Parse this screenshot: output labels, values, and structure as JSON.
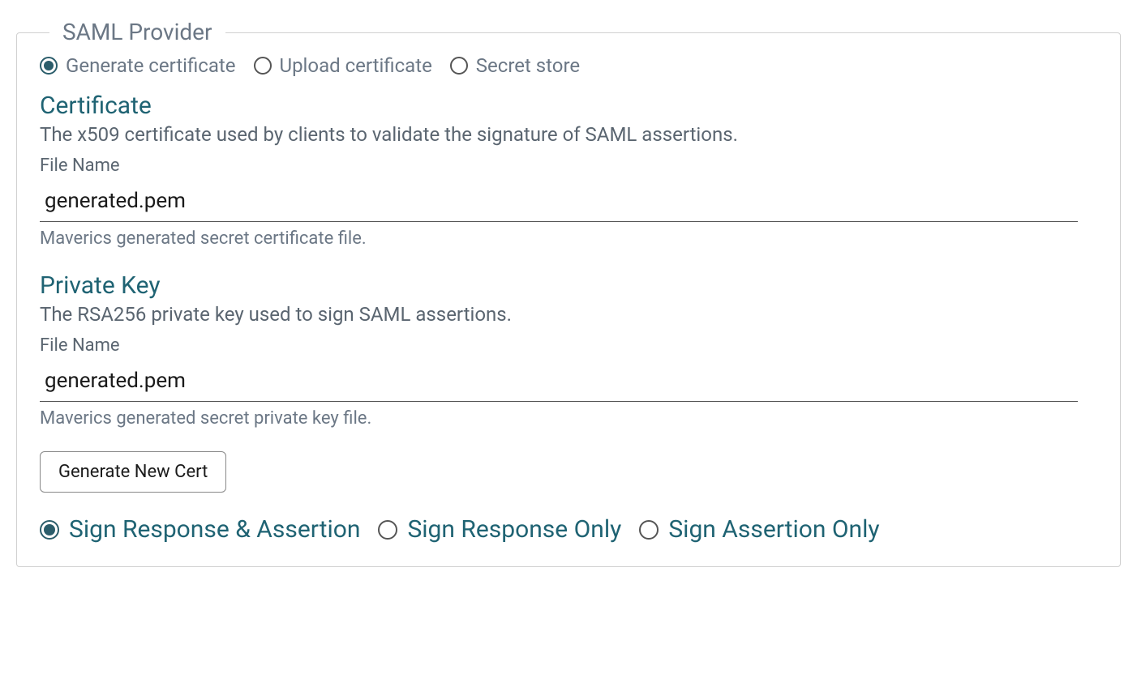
{
  "fieldset": {
    "legend": "SAML Provider",
    "sourceOptions": [
      {
        "label": "Generate certificate",
        "selected": true
      },
      {
        "label": "Upload certificate",
        "selected": false
      },
      {
        "label": "Secret store",
        "selected": false
      }
    ],
    "certificate": {
      "title": "Certificate",
      "description": "The x509 certificate used by clients to validate the signature of SAML assertions.",
      "fieldLabel": "File Name",
      "value": "generated.pem",
      "helper": "Maverics generated secret certificate file."
    },
    "privateKey": {
      "title": "Private Key",
      "description": "The RSA256 private key used to sign SAML assertions.",
      "fieldLabel": "File Name",
      "value": "generated.pem",
      "helper": "Maverics generated secret private key file."
    },
    "generateButton": "Generate New Cert",
    "signOptions": [
      {
        "label": "Sign Response & Assertion",
        "selected": true
      },
      {
        "label": "Sign Response Only",
        "selected": false
      },
      {
        "label": "Sign Assertion Only",
        "selected": false
      }
    ]
  }
}
